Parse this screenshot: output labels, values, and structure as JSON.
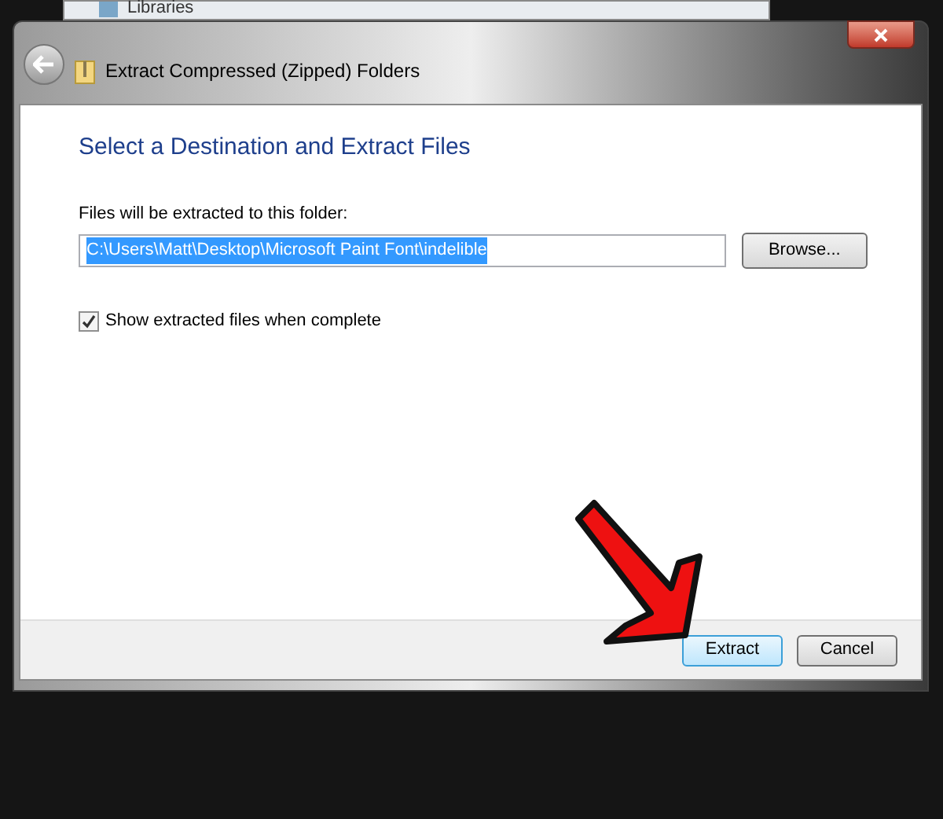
{
  "background_window": {
    "item": "Libraries"
  },
  "window": {
    "title": "Extract Compressed (Zipped) Folders"
  },
  "heading": "Select a Destination and Extract Files",
  "folder_label": "Files will be extracted to this folder:",
  "folder_field": {
    "value": "C:\\Users\\Matt\\Desktop\\Microsoft Paint Font\\indelible",
    "selected": true
  },
  "browse_button": "Browse...",
  "show_files": {
    "label": "Show extracted files when complete",
    "checked": true
  },
  "buttons": [
    {
      "label": "Extract",
      "default": true
    },
    {
      "label": "Cancel",
      "default": false
    }
  ]
}
